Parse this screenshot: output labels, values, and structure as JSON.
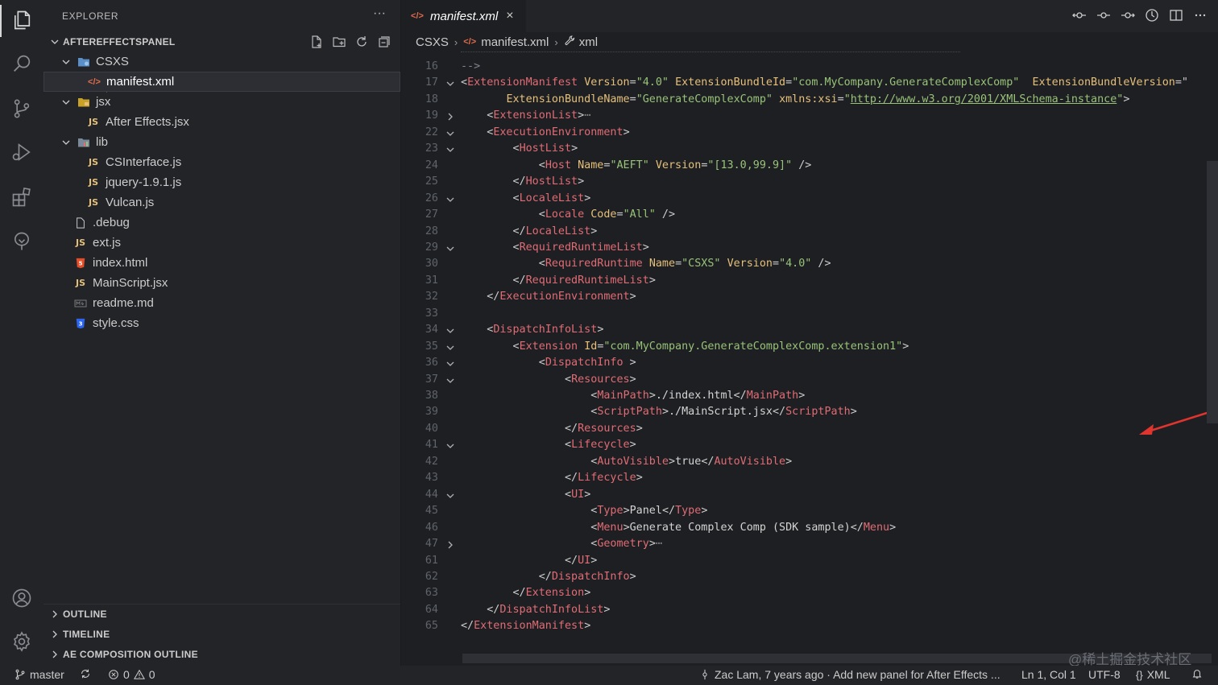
{
  "sidebar": {
    "title": "EXPLORER",
    "more": "···",
    "project": "AFTEREFFECTSPANEL",
    "tree": [
      {
        "label": "CSXS",
        "kind": "folder"
      },
      {
        "label": "manifest.xml",
        "kind": "xml"
      },
      {
        "label": "jsx",
        "kind": "folder"
      },
      {
        "label": "After Effects.jsx",
        "kind": "js"
      },
      {
        "label": "lib",
        "kind": "folder"
      },
      {
        "label": "CSInterface.js",
        "kind": "js"
      },
      {
        "label": "jquery-1.9.1.js",
        "kind": "js"
      },
      {
        "label": "Vulcan.js",
        "kind": "js"
      },
      {
        "label": ".debug",
        "kind": "file"
      },
      {
        "label": "ext.js",
        "kind": "js"
      },
      {
        "label": "index.html",
        "kind": "html"
      },
      {
        "label": "MainScript.jsx",
        "kind": "js"
      },
      {
        "label": "readme.md",
        "kind": "md"
      },
      {
        "label": "style.css",
        "kind": "css"
      }
    ],
    "bottom_sections": [
      "OUTLINE",
      "TIMELINE",
      "AE COMPOSITION OUTLINE"
    ]
  },
  "editor": {
    "tab_label": "manifest.xml",
    "tab_icon_text": "</>",
    "close": "×",
    "breadcrumb": [
      "CSXS",
      "manifest.xml",
      "xml"
    ]
  },
  "code_lines": [
    {
      "n": "16",
      "fold": ""
    },
    {
      "n": "17",
      "fold": "down"
    },
    {
      "n": "18",
      "fold": ""
    },
    {
      "n": "19",
      "fold": "right"
    },
    {
      "n": "22",
      "fold": "down"
    },
    {
      "n": "23",
      "fold": "down"
    },
    {
      "n": "24",
      "fold": ""
    },
    {
      "n": "25",
      "fold": ""
    },
    {
      "n": "26",
      "fold": "down"
    },
    {
      "n": "27",
      "fold": ""
    },
    {
      "n": "28",
      "fold": ""
    },
    {
      "n": "29",
      "fold": "down"
    },
    {
      "n": "30",
      "fold": ""
    },
    {
      "n": "31",
      "fold": ""
    },
    {
      "n": "32",
      "fold": ""
    },
    {
      "n": "33",
      "fold": ""
    },
    {
      "n": "34",
      "fold": "down"
    },
    {
      "n": "35",
      "fold": "down"
    },
    {
      "n": "36",
      "fold": "down"
    },
    {
      "n": "37",
      "fold": "down"
    },
    {
      "n": "38",
      "fold": ""
    },
    {
      "n": "39",
      "fold": ""
    },
    {
      "n": "40",
      "fold": ""
    },
    {
      "n": "41",
      "fold": "down"
    },
    {
      "n": "42",
      "fold": ""
    },
    {
      "n": "43",
      "fold": ""
    },
    {
      "n": "44",
      "fold": "down"
    },
    {
      "n": "45",
      "fold": ""
    },
    {
      "n": "46",
      "fold": ""
    },
    {
      "n": "47",
      "fold": "right"
    },
    {
      "n": "61",
      "fold": ""
    },
    {
      "n": "62",
      "fold": ""
    },
    {
      "n": "63",
      "fold": ""
    },
    {
      "n": "64",
      "fold": ""
    },
    {
      "n": "65",
      "fold": ""
    }
  ],
  "code": {
    "l16": "-->",
    "l17": {
      "open": "<",
      "tag": "ExtensionManifest",
      "a1": "Version",
      "v1": "\"4.0\"",
      "a2": "ExtensionBundleId",
      "v2": "\"com.MyCompany.GenerateComplexComp\"",
      "a3": "ExtensionBundleVersion",
      "eq3": "=\""
    },
    "l18": {
      "a1": "ExtensionBundleName",
      "v1": "\"GenerateComplexComp\"",
      "a2": "xmlns:xsi",
      "q2a": "\"",
      "url": "http://www.w3.org/2001/XMLSchema-instance",
      "q2b": "\"",
      "close": ">"
    },
    "l19": {
      "tag": "ExtensionList",
      "tail": ">",
      "dots": "⋯"
    },
    "l22": "ExecutionEnvironment",
    "l23": "HostList",
    "l24": {
      "tag": "Host",
      "a1": "Name",
      "v1": "\"AEFT\"",
      "a2": "Version",
      "v2": "\"[13.0,99.9]\"",
      "end": " />"
    },
    "l25": "HostList",
    "l26": "LocaleList",
    "l27": {
      "tag": "Locale",
      "a1": "Code",
      "v1": "\"All\"",
      "end": " />"
    },
    "l28": "LocaleList",
    "l29": "RequiredRuntimeList",
    "l30": {
      "tag": "RequiredRuntime",
      "a1": "Name",
      "v1": "\"CSXS\"",
      "a2": "Version",
      "v2": "\"4.0\"",
      "end": " />"
    },
    "l31": "RequiredRuntimeList",
    "l32": "ExecutionEnvironment",
    "l34": "DispatchInfoList",
    "l35": {
      "tag": "Extension",
      "a1": "Id",
      "v1": "\"com.MyCompany.GenerateComplexComp.extension1\""
    },
    "l36": {
      "tag": "DispatchInfo",
      "end": " >"
    },
    "l37": "Resources",
    "l38": {
      "tag": "MainPath",
      "text": "./index.html"
    },
    "l39": {
      "tag": "ScriptPath",
      "text": "./MainScript.jsx"
    },
    "l40": "Resources",
    "l41": "Lifecycle",
    "l42": {
      "tag": "AutoVisible",
      "text": "true"
    },
    "l43": "Lifecycle",
    "l44": "UI",
    "l45": {
      "tag": "Type",
      "text": "Panel"
    },
    "l46": {
      "tag": "Menu",
      "text": "Generate Complex Comp (SDK sample)"
    },
    "l47": {
      "tag": "Geometry",
      "tail": ">",
      "dots": "⋯"
    },
    "l61": "UI",
    "l62": "DispatchInfo",
    "l63": "Extension",
    "l64": "DispatchInfoList",
    "l65": "ExtensionManifest"
  },
  "statusbar": {
    "branch": "master",
    "errors": "0",
    "warnings": "0",
    "blame": "Zac Lam, 7 years ago · Add new panel for After Effects ...",
    "cursor": "Ln 1, Col 1",
    "encoding": "UTF-8",
    "language": "XML"
  },
  "watermark": "@稀土掘金技术社区",
  "colors": {
    "tag": "#e06c75",
    "attr": "#e5c07b",
    "string": "#98c379",
    "accent_arrow": "#e0342e"
  }
}
